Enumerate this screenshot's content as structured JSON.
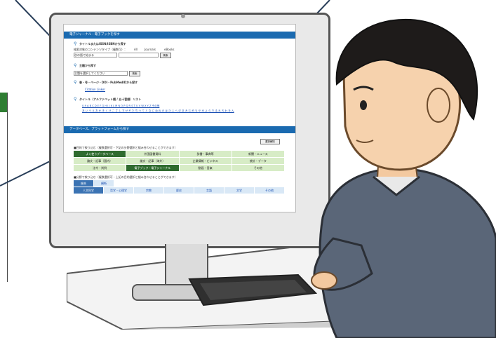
{
  "screen": {
    "section1_title": "電子ジャーナル・電子ブックを探す",
    "search_title_issn": "タイトルまたはISSN/ISBNから探す",
    "content_type_label": "検索対象のコンテンツタイプ（複数可）：",
    "content_type_all": "All",
    "content_type_journals": "Journals",
    "content_type_ebooks": "eBooks",
    "search_mode_value": "次の語で始まる",
    "search_button": "検索",
    "subject_title": "主題から探す",
    "subject_select_value": "主題を選択してください",
    "subject_button": "検索",
    "citation_title": "巻・号・ページ・DOI・PubMedIDから探す",
    "citation_link": "Citation Linker",
    "alpha_title": "タイトル（アルファベット順 / 五十音順）リスト",
    "alpha_list": "0-9 A B C D E F G H I J K L M N O P Q R S T U V W X Y Z その他",
    "kana_list": "あ い う え お か き く け こ さ し す せ そ た ち つ て と な に ぬ ね の は ひ ふ へ ほ ま み む め も や ゆ よ ら り る れ ろ わ を ん",
    "section2_title": "データベース、プラットフォームから探す",
    "select_clear_button": "選択解除",
    "purpose_label": "■目的で絞り込む（複数選択可・下記の分野選択と組み合わせることができます）",
    "purpose_cells": [
      "よく使うデータベース",
      "外国図書資料",
      "辞書・事典等",
      "新聞・ニュース",
      "論文・記事（国内）",
      "論文・記事（海外）",
      "企業情報・ビジネス",
      "統計・データ",
      "法令・判例",
      "電子ブック・電子ジャーナル",
      "動画・音楽",
      "その他"
    ],
    "field_label": "■分野で絞り込む（複数選択可・上記の目的選択と組み合わせることができます）",
    "field_tabs": [
      "総合",
      "横断"
    ],
    "field_cells": [
      "人文科学",
      "哲学・心理学",
      "宗教",
      "歴史",
      "言語",
      "文学",
      "その他"
    ]
  }
}
